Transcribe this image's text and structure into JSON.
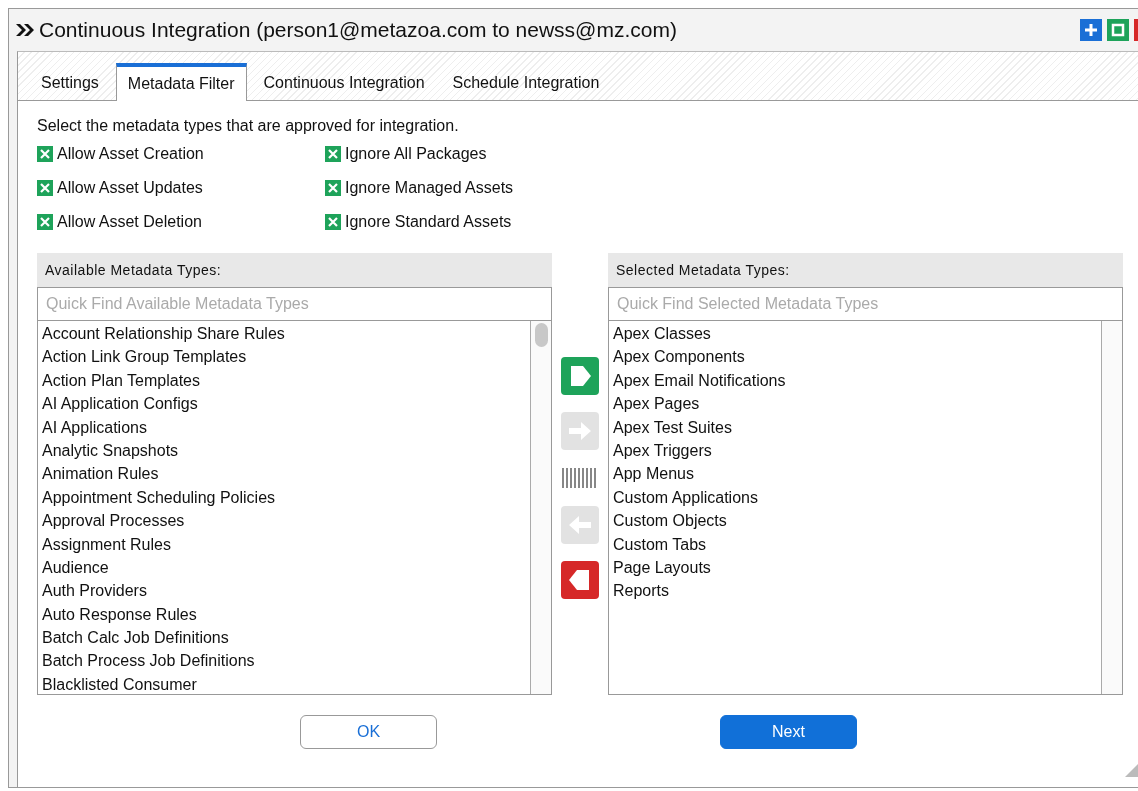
{
  "window": {
    "title": "Continuous Integration (person1@metazoa.com to newss@mz.com)"
  },
  "tabs": [
    {
      "label": "Settings",
      "selected": false
    },
    {
      "label": "Metadata Filter",
      "selected": true
    },
    {
      "label": "Continuous Integration",
      "selected": false
    },
    {
      "label": "Schedule Integration",
      "selected": false
    }
  ],
  "instructions": "Select the metadata types that are approved for integration.",
  "options": [
    {
      "label": "Allow Asset Creation",
      "checked": true
    },
    {
      "label": "Ignore All Packages",
      "checked": true
    },
    {
      "label": "Allow Asset Updates",
      "checked": true
    },
    {
      "label": "Ignore Managed Assets",
      "checked": true
    },
    {
      "label": "Allow Asset Deletion",
      "checked": true
    },
    {
      "label": "Ignore Standard Assets",
      "checked": true
    }
  ],
  "available": {
    "header": "Available Metadata Types:",
    "search": {
      "placeholder": "Quick Find Available Metadata Types"
    },
    "items": [
      "Account Relationship Share Rules",
      "Action Link Group Templates",
      "Action Plan Templates",
      "AI Application Configs",
      "AI Applications",
      "Analytic Snapshots",
      "Animation Rules",
      "Appointment Scheduling Policies",
      "Approval Processes",
      "Assignment Rules",
      "Audience",
      "Auth Providers",
      "Auto Response Rules",
      "Batch Calc Job Definitions",
      "Batch Process Job Definitions",
      "Blacklisted Consumer"
    ]
  },
  "transfer_buttons": [
    {
      "kind": "add_all",
      "disabled": false
    },
    {
      "kind": "add",
      "disabled": true
    },
    {
      "kind": "handle"
    },
    {
      "kind": "remove",
      "disabled": true
    },
    {
      "kind": "remove_all",
      "disabled": false
    }
  ],
  "selected": {
    "header": "Selected Metadata Types:",
    "search": {
      "placeholder": "Quick Find Selected Metadata Types"
    },
    "items": [
      "Apex Classes",
      "Apex Components",
      "Apex Email Notifications",
      "Apex Pages",
      "Apex Test Suites",
      "Apex Triggers",
      "App Menus",
      "Custom Applications",
      "Custom Objects",
      "Custom Tabs",
      "Page Layouts",
      "Reports"
    ]
  },
  "buttons": [
    {
      "label": "OK",
      "kind": "secondary"
    },
    {
      "label": "Next",
      "kind": "primary"
    }
  ]
}
